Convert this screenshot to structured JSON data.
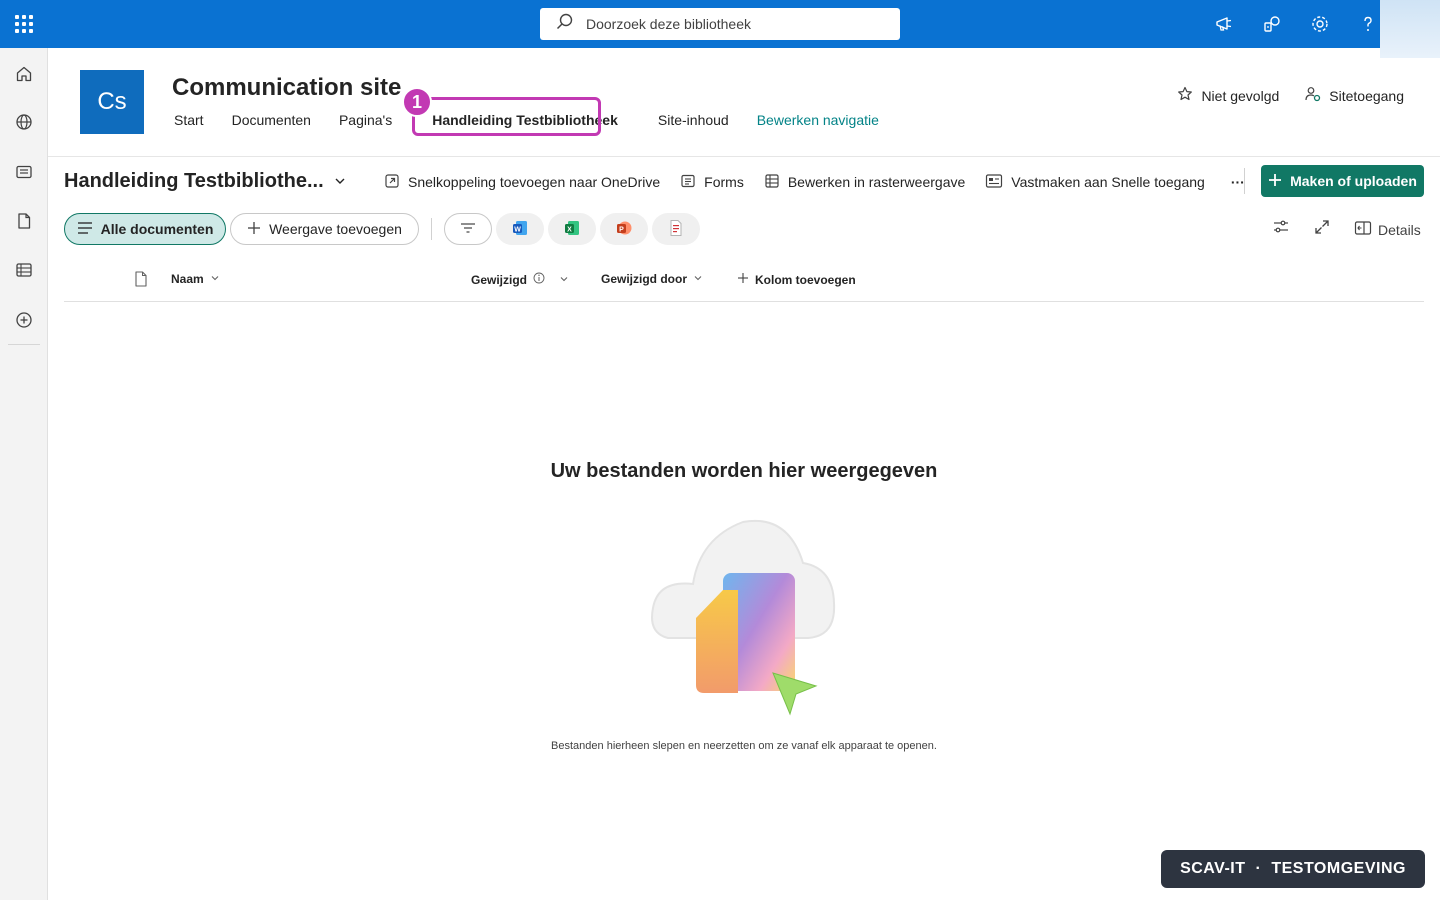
{
  "header": {
    "search_placeholder": "Doorzoek deze bibliotheek"
  },
  "site": {
    "logo_initials": "Cs",
    "title": "Communication site",
    "nav": [
      {
        "label": "Start"
      },
      {
        "label": "Documenten"
      },
      {
        "label": "Pagina's"
      },
      {
        "label": "Handleiding Testbibliotheek"
      },
      {
        "label": "Site-inhoud"
      },
      {
        "label": "Bewerken navigatie"
      }
    ],
    "follow_label": "Niet gevolgd",
    "access_label": "Sitetoegang",
    "callout_number": "1"
  },
  "library": {
    "title": "Handleiding Testbibliothe...",
    "commands": {
      "shortcut": "Snelkoppeling toevoegen naar OneDrive",
      "forms": "Forms",
      "grid": "Bewerken in rasterweergave",
      "pin": "Vastmaken aan Snelle toegang",
      "more": "···"
    },
    "create_button": "Maken of uploaden",
    "views": {
      "current": "Alle documenten",
      "add": "Weergave toevoegen"
    },
    "details_label": "Details",
    "columns": {
      "name": "Naam",
      "modified": "Gewijzigd",
      "modified_by": "Gewijzigd door",
      "add_column": "Kolom toevoegen"
    },
    "empty": {
      "title": "Uw bestanden worden hier weergegeven",
      "subtitle": "Bestanden hierheen slepen en neerzetten om ze vanaf elk apparaat te openen."
    }
  },
  "watermark": {
    "left": "SCAV-IT",
    "sep": "·",
    "right": "TESTOMGEVING"
  },
  "colors": {
    "suite_bar": "#0a72d2",
    "accent": "#117865",
    "highlight": "#c239b3",
    "logo": "#0f6cbd"
  }
}
